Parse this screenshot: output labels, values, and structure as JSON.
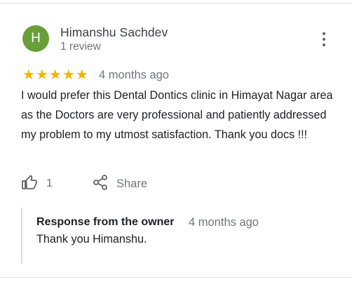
{
  "review": {
    "avatar_letter": "H",
    "avatar_color": "#689f38",
    "reviewer_name": "Himanshu Sachdev",
    "reviewer_subtitle": "1 review",
    "rating": 5,
    "rating_max": 5,
    "star_color": "#f4b400",
    "time_ago": "4 months ago",
    "text": "I would prefer this Dental Dontics clinic in Himayat Nagar area as the Doctors are very professional and patiently addressed my problem to my utmost satisfaction. Thank you docs !!!",
    "more_icon": "more-vert-icon"
  },
  "actions": {
    "like_icon": "thumbs-up-icon",
    "like_count": "1",
    "share_icon": "share-icon",
    "share_label": "Share"
  },
  "owner_response": {
    "title": "Response from the owner",
    "time_ago": "4 months ago",
    "text": "Thank you Himanshu."
  }
}
